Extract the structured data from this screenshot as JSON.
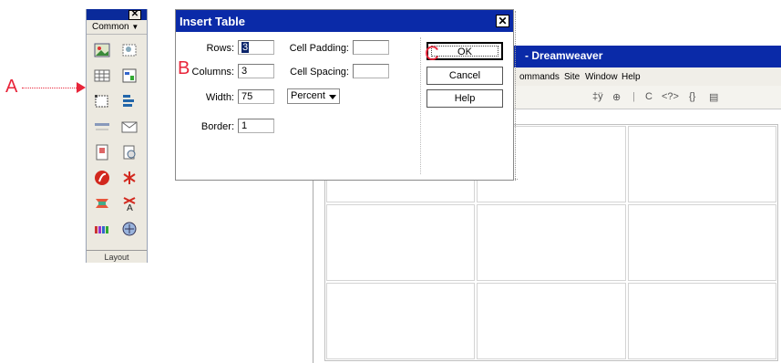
{
  "annotations": {
    "a": "A",
    "b": "B",
    "c": "C"
  },
  "insert_panel": {
    "category": "Common",
    "footer": "Layout",
    "icons": [
      "image-icon",
      "image-placeholder-icon",
      "table-icon",
      "tabular-data-icon",
      "layer-icon",
      "navigation-bar-icon",
      "horizontal-rule-icon",
      "email-link-icon",
      "named-anchor-icon",
      "date-icon",
      "flash-icon",
      "flash-button-icon",
      "fireworks-html-icon",
      "flash-text-icon",
      "rollover-icon",
      "server-side-include-icon"
    ]
  },
  "dreamweaver": {
    "title": "- Dreamweaver",
    "menu": [
      "ommands",
      "Site",
      "Window",
      "Help"
    ],
    "toolbar": [
      "‡ÿ",
      "⊕",
      "C",
      "<?>",
      "{}",
      "▤"
    ]
  },
  "dialog": {
    "title": "Insert Table",
    "rows_label": "Rows:",
    "rows_value": "3",
    "columns_label": "Columns:",
    "columns_value": "3",
    "width_label": "Width:",
    "width_value": "75",
    "width_unit": "Percent",
    "border_label": "Border:",
    "border_value": "1",
    "cell_padding_label": "Cell Padding:",
    "cell_padding_value": "",
    "cell_spacing_label": "Cell Spacing:",
    "cell_spacing_value": "",
    "ok_label": "OK",
    "cancel_label": "Cancel",
    "help_label": "Help"
  },
  "colors": {
    "titlebar": "#0a2aa8",
    "annotation": "#e8253a"
  }
}
